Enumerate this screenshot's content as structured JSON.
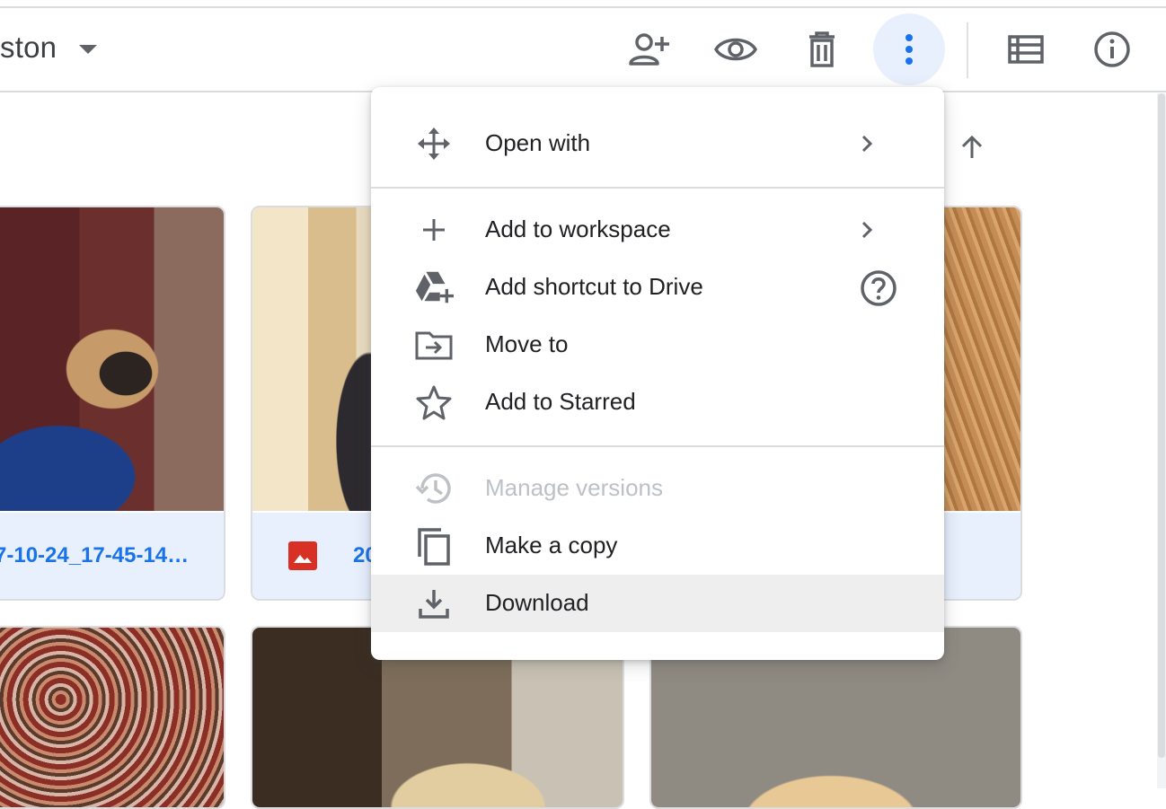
{
  "header": {
    "folder_title": "ston",
    "toolbar": {
      "share_icon": "person-add-icon",
      "preview_icon": "eye-icon",
      "delete_icon": "trash-icon",
      "more_icon": "more-vert-icon",
      "list_view_icon": "list-view-icon",
      "details_icon": "info-icon"
    }
  },
  "files": [
    {
      "name": "7-10-24_17-45-14…"
    },
    {
      "name": "20"
    }
  ],
  "menu": {
    "items": [
      {
        "label": "Open with",
        "icon": "move-arrows-icon",
        "submenu": true
      },
      {
        "label": "Add to workspace",
        "icon": "plus-icon",
        "submenu": true
      },
      {
        "label": "Add shortcut to Drive",
        "icon": "drive-add-icon",
        "help": true
      },
      {
        "label": "Move to",
        "icon": "folder-move-icon"
      },
      {
        "label": "Add to Starred",
        "icon": "star-icon"
      },
      {
        "label": "Manage versions",
        "icon": "history-icon",
        "disabled": true
      },
      {
        "label": "Make a copy",
        "icon": "copy-icon"
      },
      {
        "label": "Download",
        "icon": "download-icon",
        "hovered": true
      }
    ]
  },
  "colors": {
    "accent": "#1a73e8",
    "active_button_bg": "#e8f0fe",
    "hover_bg": "#eeeeee",
    "disabled_text": "#bdc1c6",
    "image_badge": "#d93025"
  }
}
